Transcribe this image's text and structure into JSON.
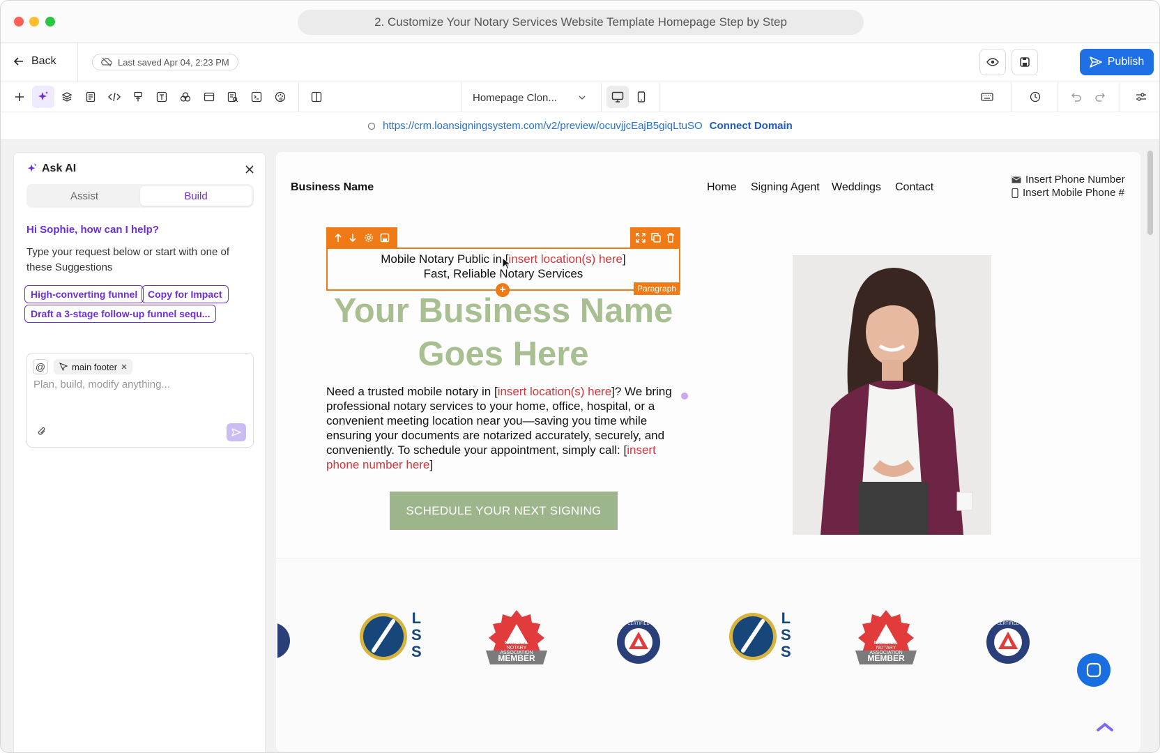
{
  "window": {
    "title": "2. Customize Your Notary Services Website Template Homepage Step by Step"
  },
  "topbar": {
    "back_label": "Back",
    "saved_label": "Last saved Apr 04, 2:23 PM",
    "publish_label": "Publish"
  },
  "toolbar": {
    "page_select": "Homepage Clon...",
    "tools": [
      "plus-icon",
      "sparkle-icon",
      "layers-icon",
      "page-icon",
      "code-icon",
      "paint-icon",
      "text-icon",
      "shapes-icon",
      "section-icon",
      "form-icon",
      "terminal-icon",
      "palette-icon",
      "columns-icon"
    ]
  },
  "urlbar": {
    "url": "https://crm.loansigningsystem.com/v2/preview/ocuvjjcEajB5giqLtuSO",
    "connect_label": "Connect Domain"
  },
  "ai_panel": {
    "title": "Ask AI",
    "tabs": [
      "Assist",
      "Build"
    ],
    "active_tab": "Build",
    "greeting": "Hi Sophie, how can I help?",
    "hint": "Type your request below or start with one of these Suggestions",
    "suggestions": [
      "High-converting funnel",
      "Copy for Impact",
      "Draft a 3-stage follow-up funnel sequ..."
    ],
    "context_chip": "main footer",
    "input_placeholder": "Plan, build, modify anything..."
  },
  "site": {
    "brand": "Business Name",
    "nav": [
      "Home",
      "Signing Agent",
      "Weddings",
      "Contact"
    ],
    "phone": "Insert Phone Number",
    "mobile": "Insert Mobile Phone #",
    "selected_tag": "Paragraph",
    "para_line1_pre": "Mobile Notary Public in [",
    "para_line1_red": "insert location(s) here",
    "para_line1_post": "]",
    "para_line2": "Fast, Reliable Notary Services",
    "business_name_line1": "Your Business Name",
    "business_name_line2": "Goes Here",
    "body_pre": "Need a trusted mobile notary in [",
    "body_red1": "insert location(s) here",
    "body_mid": "]? We bring professional notary services to your home, office, hospital, or a convenient meeting location near you—saving you time while ensuring your documents are notarized accurately, securely, and conveniently. To schedule your appointment, simply call: [",
    "body_red2": "insert phone number here",
    "body_post": "]",
    "cta_label": "SCHEDULE YOUR NEXT SIGNING",
    "badges": {
      "lss_letters": [
        "L",
        "S",
        "S"
      ],
      "nna_text": "NATIONAL NOTARY ASSOCIATION",
      "nna_member": "MEMBER",
      "certified_text": "CERTIFIED"
    }
  },
  "colors": {
    "accent": "#6b2fd6",
    "publish": "#1f6fe5",
    "selection": "#f07b16",
    "sage": "#a8bf91",
    "link_red": "#d0363a"
  }
}
